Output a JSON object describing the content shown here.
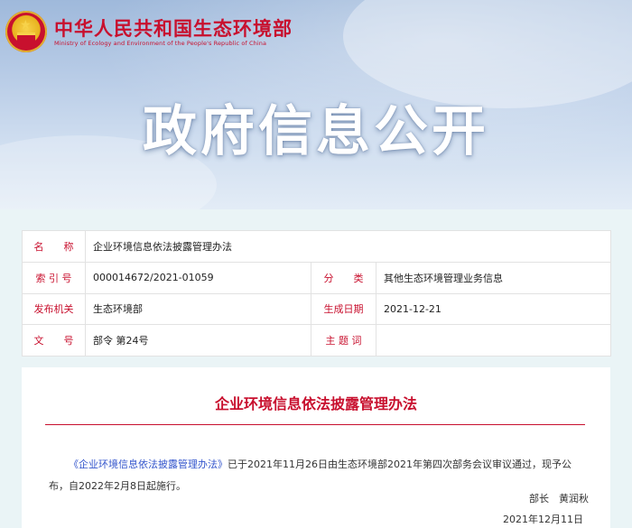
{
  "header": {
    "ministry_cn": "中华人民共和国生态环境部",
    "ministry_en": "Ministry of Ecology and Environment of the People's Republic of China",
    "hero_title": "政府信息公开"
  },
  "meta": {
    "name_label": "名　　称",
    "name_value": "企业环境信息依法披露管理办法",
    "index_label": "索 引 号",
    "index_value": "000014672/2021-01059",
    "category_label": "分　　类",
    "category_value": "其他生态环境管理业务信息",
    "issuer_label": "发布机关",
    "issuer_value": "生态环境部",
    "date_label": "生成日期",
    "date_value": "2021-12-21",
    "docno_label": "文　　号",
    "docno_value": "部令 第24号",
    "subject_label": "主 题 词",
    "subject_value": ""
  },
  "content": {
    "title": "企业环境信息依法披露管理办法",
    "link_text": "《企业环境信息依法披露管理办法》",
    "body": "已于2021年11月26日由生态环境部2021年第四次部务会议审议通过，现予公布，自2022年2月8日起施行。",
    "signature": "部长　黄润秋",
    "sign_date": "2021年12月11日"
  },
  "colors": {
    "accent_red": "#c8102e",
    "link_blue": "#3355cc",
    "page_bg": "#eaf4f6"
  },
  "icons": [
    "national-emblem-icon"
  ]
}
